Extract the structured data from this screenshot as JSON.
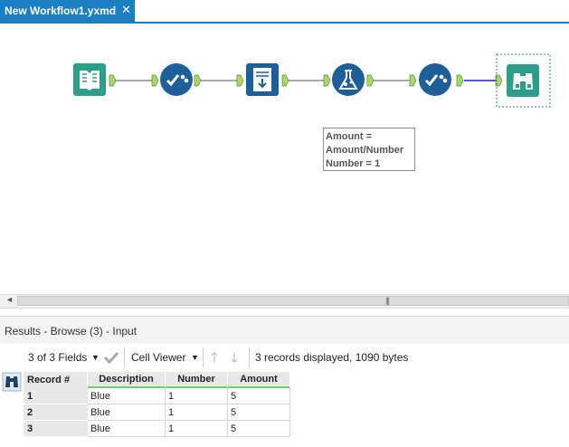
{
  "tab": {
    "title": "New Workflow1.yxmd",
    "close": "✕"
  },
  "workflow": {
    "tools": [
      {
        "name": "input-data-icon"
      },
      {
        "name": "select-icon"
      },
      {
        "name": "record-id-icon"
      },
      {
        "name": "formula-icon"
      },
      {
        "name": "select-icon"
      },
      {
        "name": "browse-icon"
      }
    ],
    "annotation": [
      "Amount =",
      "Amount/Number",
      "Number = 1"
    ]
  },
  "results": {
    "header": "Results - Browse (3) - Input",
    "fields_label": "3 of 3 Fields",
    "viewer_label": "Cell Viewer",
    "status": "3 records displayed, 1090 bytes",
    "columns": [
      "Record #",
      "Description",
      "Number",
      "Amount"
    ],
    "rows": [
      [
        "1",
        "Blue",
        "1",
        "5"
      ],
      [
        "2",
        "Blue",
        "1",
        "5"
      ],
      [
        "3",
        "Blue",
        "1",
        "5"
      ]
    ]
  },
  "colors": {
    "accent": "#1b7fc4",
    "input": "#2aa08a",
    "select": "#1c5f99",
    "formula": "#1c5f99",
    "browse": "#2aa08a",
    "anchor": "#a6d96a"
  }
}
